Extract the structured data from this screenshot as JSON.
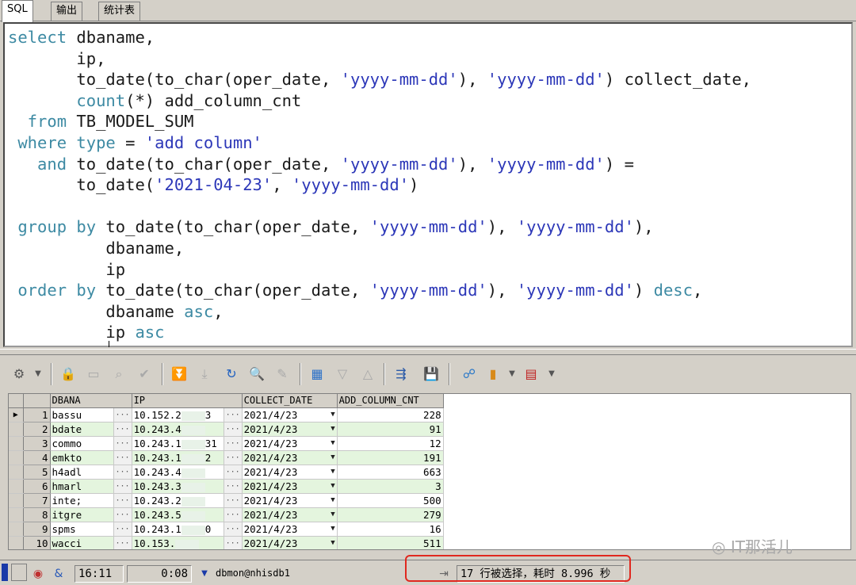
{
  "tabs": [
    {
      "label": "SQL"
    },
    {
      "label": "输出"
    },
    {
      "label": "统计表"
    }
  ],
  "sql": {
    "lines": [
      [
        {
          "t": "kw",
          "v": "select"
        },
        {
          "t": "pl",
          "v": " dbaname,"
        }
      ],
      [
        {
          "t": "pl",
          "v": "       ip,"
        }
      ],
      [
        {
          "t": "pl",
          "v": "       to_date(to_char(oper_date, "
        },
        {
          "t": "str",
          "v": "'yyyy-mm-dd'"
        },
        {
          "t": "pl",
          "v": "), "
        },
        {
          "t": "str",
          "v": "'yyyy-mm-dd'"
        },
        {
          "t": "pl",
          "v": ") collect_date,"
        }
      ],
      [
        {
          "t": "kw",
          "v": "       count"
        },
        {
          "t": "pl",
          "v": "(*) add_column_cnt"
        }
      ],
      [
        {
          "t": "kw",
          "v": "  from"
        },
        {
          "t": "pl",
          "v": " TB_MODEL_SUM"
        }
      ],
      [
        {
          "t": "kw",
          "v": " where type"
        },
        {
          "t": "pl",
          "v": " = "
        },
        {
          "t": "str",
          "v": "'add column'"
        }
      ],
      [
        {
          "t": "kw",
          "v": "   and"
        },
        {
          "t": "pl",
          "v": " to_date(to_char(oper_date, "
        },
        {
          "t": "str",
          "v": "'yyyy-mm-dd'"
        },
        {
          "t": "pl",
          "v": "), "
        },
        {
          "t": "str",
          "v": "'yyyy-mm-dd'"
        },
        {
          "t": "pl",
          "v": ") ="
        }
      ],
      [
        {
          "t": "pl",
          "v": "       to_date("
        },
        {
          "t": "str",
          "v": "'2021-04-23'"
        },
        {
          "t": "pl",
          "v": ", "
        },
        {
          "t": "str",
          "v": "'yyyy-mm-dd'"
        },
        {
          "t": "pl",
          "v": ")"
        }
      ],
      [
        {
          "t": "pl",
          "v": ""
        }
      ],
      [
        {
          "t": "kw",
          "v": " group by"
        },
        {
          "t": "pl",
          "v": " to_date(to_char(oper_date, "
        },
        {
          "t": "str",
          "v": "'yyyy-mm-dd'"
        },
        {
          "t": "pl",
          "v": "), "
        },
        {
          "t": "str",
          "v": "'yyyy-mm-dd'"
        },
        {
          "t": "pl",
          "v": "),"
        }
      ],
      [
        {
          "t": "pl",
          "v": "          dbaname,"
        }
      ],
      [
        {
          "t": "pl",
          "v": "          ip"
        }
      ],
      [
        {
          "t": "kw",
          "v": " order by"
        },
        {
          "t": "pl",
          "v": " to_date(to_char(oper_date, "
        },
        {
          "t": "str",
          "v": "'yyyy-mm-dd'"
        },
        {
          "t": "pl",
          "v": "), "
        },
        {
          "t": "str",
          "v": "'yyyy-mm-dd'"
        },
        {
          "t": "pl",
          "v": ") "
        },
        {
          "t": "kw",
          "v": "desc"
        },
        {
          "t": "pl",
          "v": ","
        }
      ],
      [
        {
          "t": "pl",
          "v": "          dbaname "
        },
        {
          "t": "kw",
          "v": "asc"
        },
        {
          "t": "pl",
          "v": ","
        }
      ],
      [
        {
          "t": "pl",
          "v": "          ip "
        },
        {
          "t": "kw",
          "v": "asc"
        }
      ]
    ]
  },
  "toolbar": {
    "icons": [
      "grid-options-icon",
      "lock-icon",
      "clear-icon",
      "query-by-example-icon",
      "post-changes-icon",
      "next-record-icon",
      "last-record-icon",
      "refresh-icon",
      "find-icon",
      "clear-records-icon",
      "single-record-view-icon",
      "previous-icon",
      "next-icon",
      "export-icon",
      "save-icon",
      "connect-icon",
      "chart-icon",
      "table-icon"
    ]
  },
  "grid": {
    "columns": [
      "DBANA",
      "IP",
      "COLLECT_DATE",
      "ADD_COLUMN_CNT"
    ],
    "rows": [
      {
        "n": "1",
        "dbaname": "bassu",
        "ip": "10.152.2",
        "ip_tail": "3",
        "date": "2021/4/23",
        "cnt": "228"
      },
      {
        "n": "2",
        "dbaname": "bdate",
        "ip": "10.243.4",
        "ip_tail": "",
        "date": "2021/4/23",
        "cnt": "91"
      },
      {
        "n": "3",
        "dbaname": "commo",
        "ip": "10.243.1",
        "ip_tail": "31",
        "date": "2021/4/23",
        "cnt": "12"
      },
      {
        "n": "4",
        "dbaname": "emkto",
        "ip": "10.243.1",
        "ip_tail": "2",
        "date": "2021/4/23",
        "cnt": "191"
      },
      {
        "n": "5",
        "dbaname": "h4adl",
        "ip": "10.243.4",
        "ip_tail": "",
        "date": "2021/4/23",
        "cnt": "663"
      },
      {
        "n": "6",
        "dbaname": "hmarl",
        "ip": "10.243.3",
        "ip_tail": "",
        "date": "2021/4/23",
        "cnt": "3"
      },
      {
        "n": "7",
        "dbaname": "inte;",
        "ip": "10.243.2",
        "ip_tail": "",
        "date": "2021/4/23",
        "cnt": "500"
      },
      {
        "n": "8",
        "dbaname": "itgre",
        "ip": "10.243.5",
        "ip_tail": "",
        "date": "2021/4/23",
        "cnt": "279"
      },
      {
        "n": "9",
        "dbaname": "spms",
        "ip": "10.243.1",
        "ip_tail": "0",
        "date": "2021/4/23",
        "cnt": "16"
      },
      {
        "n": "10",
        "dbaname": "wacci",
        "ip": "10.153.",
        "ip_tail": "",
        "date": "2021/4/23",
        "cnt": "511"
      }
    ]
  },
  "status": {
    "position": "16:11",
    "elapsed": "0:08",
    "connection": "dbmon@nhisdb1",
    "message": "17 行被选择，耗时 8.996 秒"
  },
  "watermark": "IT那活儿",
  "colors": {
    "keyword": "#3d8aa3",
    "string": "#2c37b8",
    "row_alt": "#e4f5de",
    "highlight_box": "#e0281f"
  }
}
